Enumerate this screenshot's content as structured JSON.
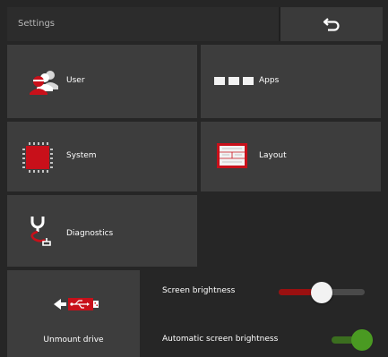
{
  "header": {
    "title": "Settings"
  },
  "tiles": {
    "user": "User",
    "apps": "Apps",
    "system": "System",
    "layout": "Layout",
    "diagnostics": "Diagnostics"
  },
  "drive": {
    "label": "Unmount drive"
  },
  "settings": {
    "brightness_label": "Screen brightness",
    "brightness_level": 0.5,
    "auto_label": "Automatic screen brightness",
    "auto_enabled": true
  },
  "colors": {
    "accent_red": "#c8101a",
    "toggle_green": "#4a9a22",
    "tile_bg": "#3d3d3d",
    "background": "#262626"
  },
  "icons": [
    "back-arrow-icon",
    "user-icon",
    "apps-icon",
    "system-chip-icon",
    "layout-icon",
    "diagnostics-icon",
    "usb-unmount-icon"
  ]
}
